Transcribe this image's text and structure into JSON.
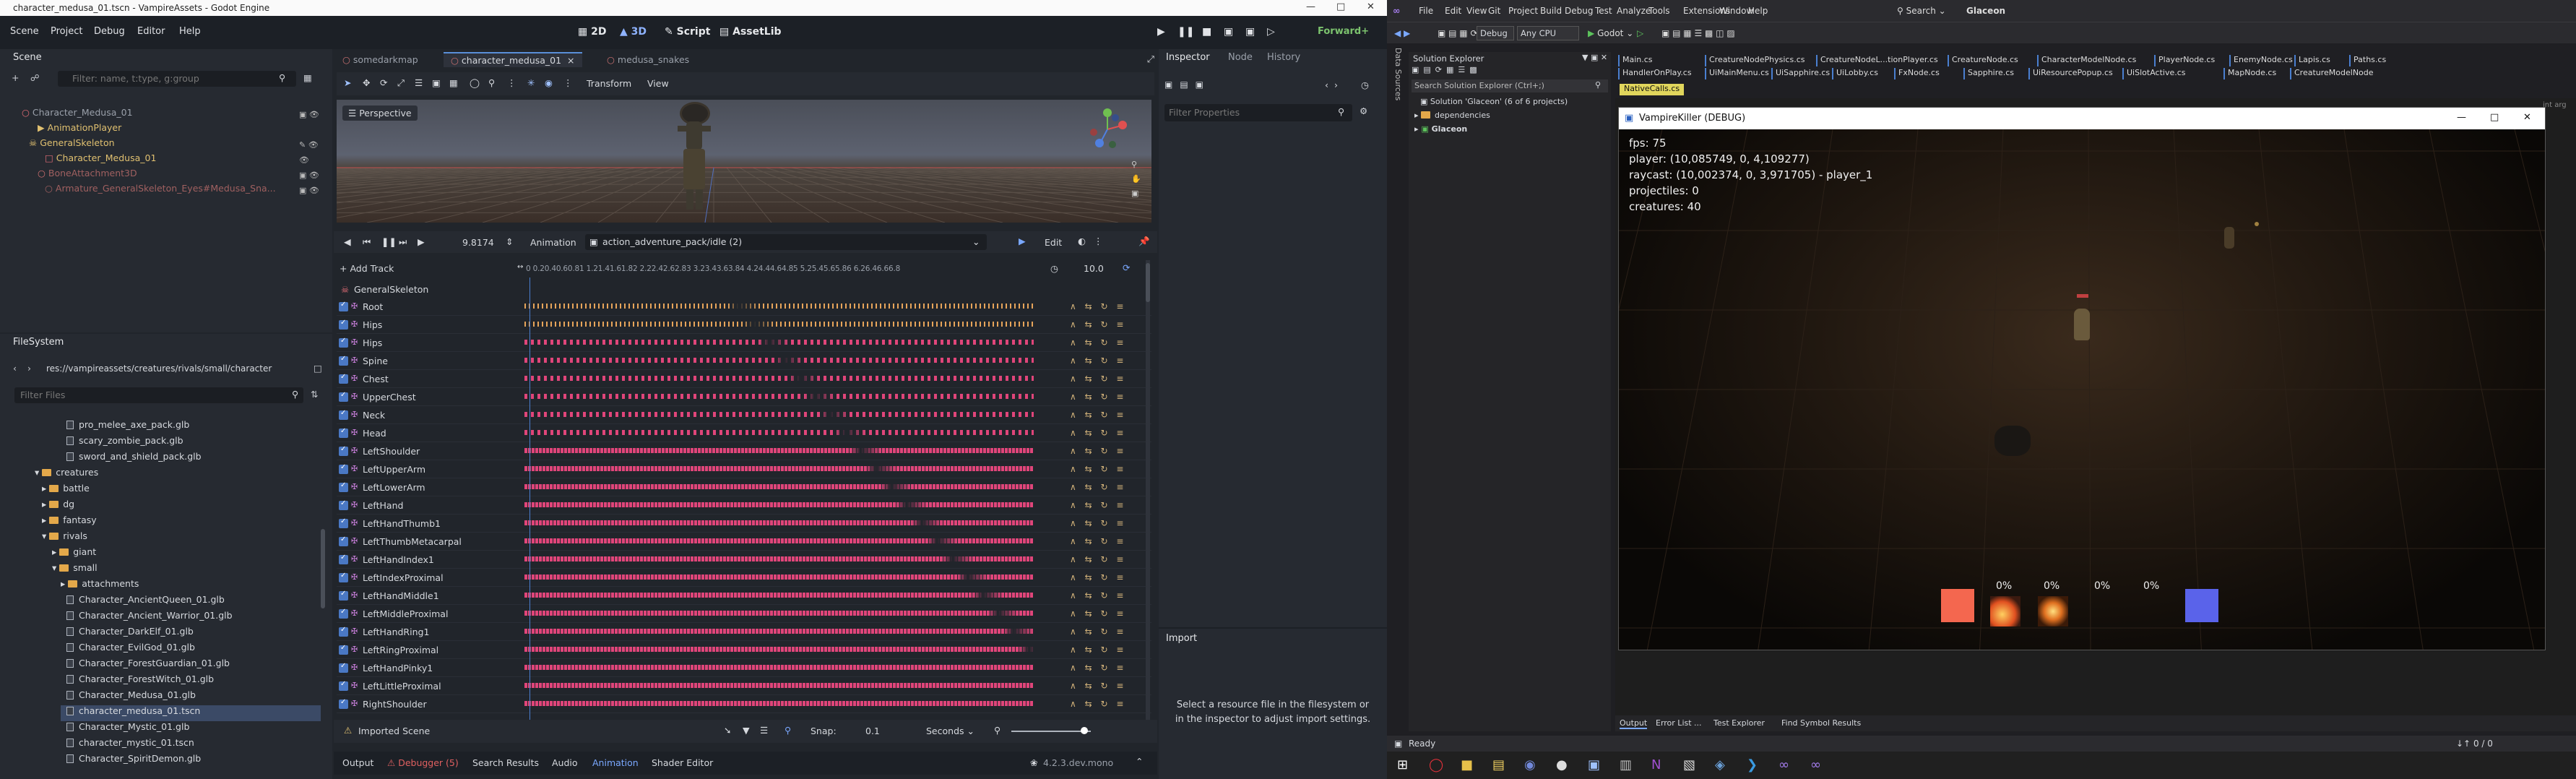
{
  "godot": {
    "window_title": "character_medusa_01.tscn - VampireAssets - Godot Engine",
    "menu": [
      "Scene",
      "Project",
      "Debug",
      "Editor",
      "Help"
    ],
    "main_buttons": [
      "2D",
      "3D",
      "Script",
      "AssetLib"
    ],
    "renderer": "Forward+",
    "scene_dock": {
      "title": "Scene",
      "filter_placeholder": "Filter: name, t:type, g:group",
      "nodes": [
        "Character_Medusa_01",
        "AnimationPlayer",
        "GeneralSkeleton",
        "Character_Medusa_01",
        "BoneAttachment3D",
        "Armature_GeneralSkeleton_Eyes#Medusa_Sna..."
      ]
    },
    "filesystem": {
      "title": "FileSystem",
      "path": "res://vampireassets/creatures/rivals/small/character",
      "filter_placeholder": "Filter Files",
      "items": [
        "pro_melee_axe_pack.glb",
        "scary_zombie_pack.glb",
        "sword_and_shield_pack.glb",
        "creatures",
        "battle",
        "dg",
        "fantasy",
        "rivals",
        "giant",
        "small",
        "attachments",
        "Character_AncientQueen_01.glb",
        "Character_Ancient_Warrior_01.glb",
        "Character_DarkElf_01.glb",
        "Character_EvilGod_01.glb",
        "Character_ForestGuardian_01.glb",
        "Character_ForestWitch_01.glb",
        "Character_Medusa_01.glb",
        "character_medusa_01.tscn",
        "Character_Mystic_01.glb",
        "character_mystic_01.tscn",
        "Character_SpiritDemon.glb"
      ]
    },
    "editor_tabs": [
      "somedarkmap",
      "character_medusa_01",
      "medusa_snakes"
    ],
    "viewport_toolbar": [
      "Transform",
      "View"
    ],
    "viewport_label": "Perspective",
    "animation": {
      "time": "9.8174",
      "label": "Animation",
      "current": "action_adventure_pack/idle (2)",
      "edit": "Edit",
      "add_track": "+ Add Track",
      "length": "10.0",
      "ruler": "0  0.20.40.60.81  1.21.41.61.82  2.22.42.62.83  3.23.43.63.84  4.24.44.64.85  5.25.45.65.86  6.26.46.66.8",
      "skeleton": "GeneralSkeleton",
      "tracks": [
        "Root",
        "Hips",
        "Hips",
        "Spine",
        "Chest",
        "UpperChest",
        "Neck",
        "Head",
        "LeftShoulder",
        "LeftUpperArm",
        "LeftLowerArm",
        "LeftHand",
        "LeftHandThumb1",
        "LeftThumbMetacarpal",
        "LeftHandIndex1",
        "LeftIndexProximal",
        "LeftHandMiddle1",
        "LeftMiddleProximal",
        "LeftHandRing1",
        "LeftRingProximal",
        "LeftHandPinky1",
        "LeftLittleProximal",
        "RightShoulder"
      ],
      "imported_scene": "Imported Scene",
      "snap_label": "Snap:",
      "snap_value": "0.1",
      "units": "Seconds"
    },
    "bottom_tabs": [
      "Output",
      "Debugger (5)",
      "Search Results",
      "Audio",
      "Animation",
      "Shader Editor"
    ],
    "version": "4.2.3.dev.mono",
    "inspector": {
      "tabs": [
        "Inspector",
        "Node",
        "History"
      ],
      "filter_placeholder": "Filter Properties",
      "import_title": "Import",
      "import_msg": "Select a resource file in the filesystem or in the inspector to adjust import settings."
    }
  },
  "vs": {
    "menu": [
      "File",
      "Edit",
      "View",
      "Git",
      "Project",
      "Build",
      "Debug",
      "Test",
      "Analyze",
      "Tools",
      "Extensions",
      "Window",
      "Help"
    ],
    "search": "Search",
    "solution_name": "Glaceon",
    "config": "Debug",
    "platform": "Any CPU",
    "run": "Godot",
    "solution_explorer": {
      "title": "Solution Explorer",
      "search": "Search Solution Explorer (Ctrl+;)",
      "items": [
        "Solution 'Glaceon' (6 of 6 projects)",
        "dependencies",
        "Glaceon"
      ]
    },
    "doc_tabs_row1": [
      "Main.cs",
      "CreatureNodePhysics.cs",
      "CreatureNodeL...tionPlayer.cs",
      "CreatureNode.cs",
      "CharacterModelNode.cs",
      "PlayerNode.cs",
      "EnemyNode.cs",
      "Lapis.cs",
      "Paths.cs"
    ],
    "doc_tabs_row2": [
      "HandlerOnPlay.cs",
      "UiMainMenu.cs",
      "UiSapphire.cs",
      "UiLobby.cs",
      "FxNode.cs",
      "Sapphire.cs",
      "UiResourcePopup.cs",
      "UiSlotActive.cs",
      "MapNode.cs",
      "CreatureModelNode"
    ],
    "active_tab": "NativeCalls.cs",
    "bottom_tabs": [
      "Output",
      "Error List ...",
      "Test Explorer",
      "Find Symbol Results"
    ],
    "status": "Ready",
    "status_right": "0 / 0",
    "left_strip": "Data Sources"
  },
  "game": {
    "title": "VampireKiller (DEBUG)",
    "fps": "fps: 75",
    "player": "player: (10,085749, 0, 4,109277)",
    "raycast": "raycast: (10,002374, 0, 3,971705) - player_1",
    "projectiles": "projectiles: 0",
    "creatures": "creatures: 40",
    "slots": [
      "0%",
      "0%",
      "0%",
      "0%"
    ],
    "colors": {
      "left_slot": "#f4674f",
      "right_slot": "#5a63ea"
    }
  }
}
